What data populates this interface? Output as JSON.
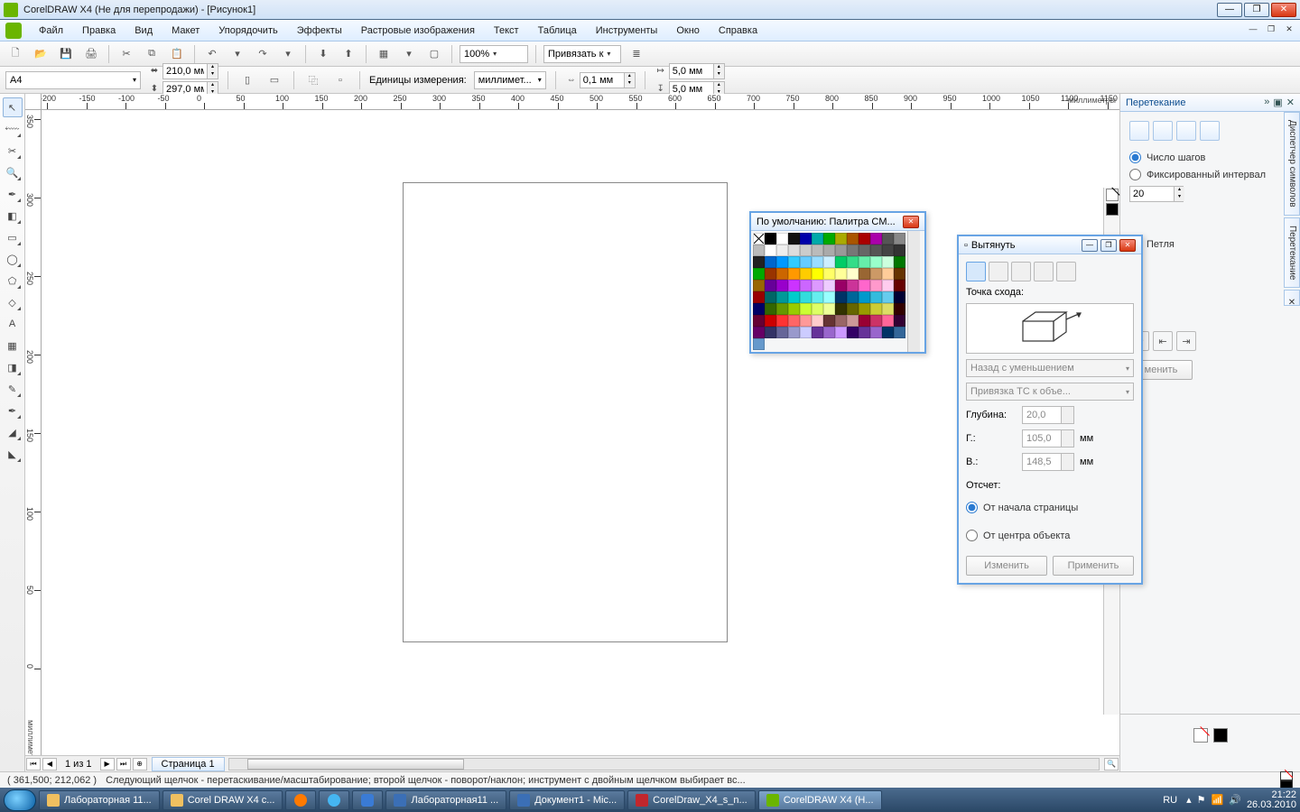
{
  "titlebar": {
    "title": "CorelDRAW X4 (Не для перепродажи) - [Рисунок1]"
  },
  "menu": {
    "items": [
      "Файл",
      "Правка",
      "Вид",
      "Макет",
      "Упорядочить",
      "Эффекты",
      "Растровые изображения",
      "Текст",
      "Таблица",
      "Инструменты",
      "Окно",
      "Справка"
    ]
  },
  "toolbar": {
    "zoom": "100%",
    "snap_label": "Привязать к"
  },
  "prop": {
    "paper": "A4",
    "width": "210,0 мм",
    "height": "297,0 мм",
    "units_label": "Единицы измерения:",
    "units": "миллимет...",
    "nudge": "0,1 мм",
    "dup_x": "5,0 мм",
    "dup_y": "5,0 мм"
  },
  "ruler": {
    "unit": "миллиметры"
  },
  "palette_panel": {
    "title": "По умолчанию: Палитра CM..."
  },
  "extrude": {
    "title": "Вытянуть",
    "vp_label": "Точка схода:",
    "type": "Назад с уменьшением",
    "lock": "Привязка ТС к объе...",
    "depth_label": "Глубина:",
    "depth": "20,0",
    "h_label": "Г.:",
    "h": "105,0",
    "v_label": "В.:",
    "v": "148,5",
    "unit": "мм",
    "from_label": "Отсчет:",
    "from_page": "От начала страницы",
    "from_obj": "От центра объекта",
    "btn_edit": "Изменить",
    "btn_apply": "Применить"
  },
  "blend": {
    "title": "Перетекание",
    "steps_label": "Число шагов",
    "fixed_label": "Фиксированный интервал",
    "steps": "20",
    "loop": "Петля",
    "apply": "менить"
  },
  "pages": {
    "counter": "1 из 1",
    "tab": "Страница 1"
  },
  "status": {
    "coords": "( 361,500; 212,062 )",
    "hint": "Следующий щелчок - перетаскивание/масштабирование; второй щелчок - поворот/наклон; инструмент с двойным щелчком выбирает вс..."
  },
  "taskbar": {
    "items": [
      "Лабораторная 11...",
      "Corel DRAW X4 с...",
      "",
      "",
      "",
      "Лабораторная11 ...",
      "Документ1 - Mic...",
      "CorelDraw_X4_s_n...",
      "CorelDRAW X4 (Н..."
    ],
    "lang": "RU",
    "time": "21:22",
    "date": "26.03.2010"
  }
}
